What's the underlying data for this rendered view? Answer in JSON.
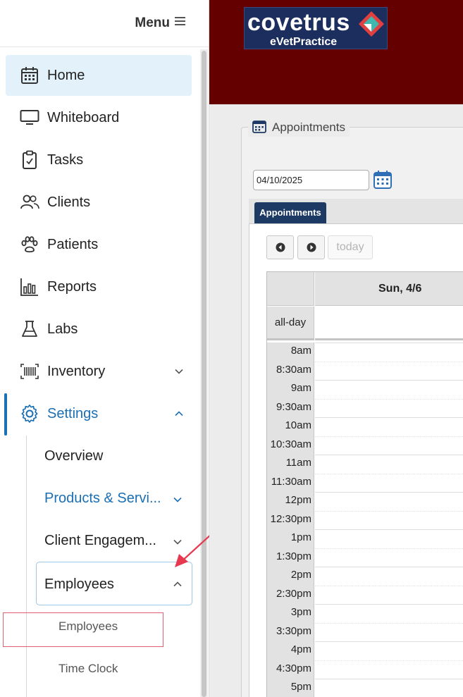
{
  "sidebar": {
    "menu_label": "Menu",
    "items": [
      {
        "label": "Home"
      },
      {
        "label": "Whiteboard"
      },
      {
        "label": "Tasks"
      },
      {
        "label": "Clients"
      },
      {
        "label": "Patients"
      },
      {
        "label": "Reports"
      },
      {
        "label": "Labs"
      },
      {
        "label": "Inventory"
      },
      {
        "label": "Settings"
      }
    ],
    "settings_sub": [
      {
        "label": "Overview"
      },
      {
        "label": "Products & Servi..."
      },
      {
        "label": "Client Engagem..."
      },
      {
        "label": "Employees"
      }
    ],
    "employees_sub": [
      {
        "label": "Employees"
      },
      {
        "label": "Time Clock"
      }
    ]
  },
  "brand": {
    "name": "covetrus",
    "product": "eVetPractice",
    "colors": {
      "topbar": "#650000",
      "accent": "#1a6fb5"
    }
  },
  "appointments": {
    "section_title": "Appointments",
    "date_value": "04/10/2025",
    "tab_label": "Appointments",
    "today_label": "today",
    "day_header": "Sun, 4/6",
    "allday_label": "all-day",
    "times": [
      "8am",
      "8:30am",
      "9am",
      "9:30am",
      "10am",
      "10:30am",
      "11am",
      "11:30am",
      "12pm",
      "12:30pm",
      "1pm",
      "1:30pm",
      "2pm",
      "2:30pm",
      "3pm",
      "3:30pm",
      "4pm",
      "4:30pm",
      "5pm"
    ]
  }
}
